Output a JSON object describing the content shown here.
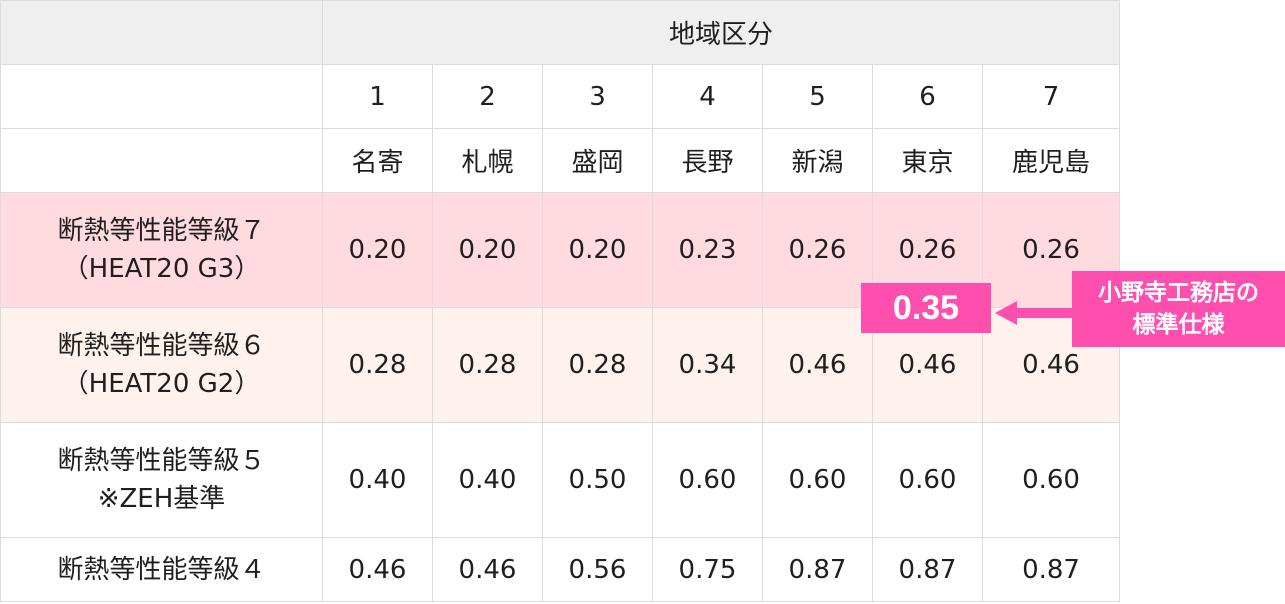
{
  "header": {
    "region_title": "地域区分"
  },
  "regions": {
    "numbers": [
      "1",
      "2",
      "3",
      "4",
      "5",
      "6",
      "7"
    ],
    "cities": [
      "名寄",
      "札幌",
      "盛岡",
      "長野",
      "新潟",
      "東京",
      "鹿児島"
    ]
  },
  "rows": [
    {
      "label_line1": "断熱等性能等級７",
      "label_line2": "（HEAT20 G3）",
      "values": [
        "0.20",
        "0.20",
        "0.20",
        "0.23",
        "0.26",
        "0.26",
        "0.26"
      ],
      "color": "#e8192c",
      "bg": "#ffdbe0"
    },
    {
      "label_line1": "断熱等性能等級６",
      "label_line2": "（HEAT20 G2）",
      "values": [
        "0.28",
        "0.28",
        "0.28",
        "0.34",
        "0.46",
        "0.46",
        "0.46"
      ],
      "color": "#f07a2a",
      "bg": "#fff1ec"
    },
    {
      "label_line1": "断熱等性能等級５",
      "label_line2": "※ZEH基準",
      "values": [
        "0.40",
        "0.40",
        "0.50",
        "0.60",
        "0.60",
        "0.60",
        "0.60"
      ],
      "color": "#1f1f1f",
      "bg": "#ffffff"
    },
    {
      "label_line1": "断熱等性能等級４",
      "label_line2": "",
      "values": [
        "0.46",
        "0.46",
        "0.56",
        "0.75",
        "0.87",
        "0.87",
        "0.87"
      ],
      "color": "#1f1f1f",
      "bg": "#ffffff"
    }
  ],
  "callout": {
    "value": "0.35",
    "note_line1": "小野寺工務店の",
    "note_line2": "標準仕様",
    "color": "#ff4fae"
  }
}
